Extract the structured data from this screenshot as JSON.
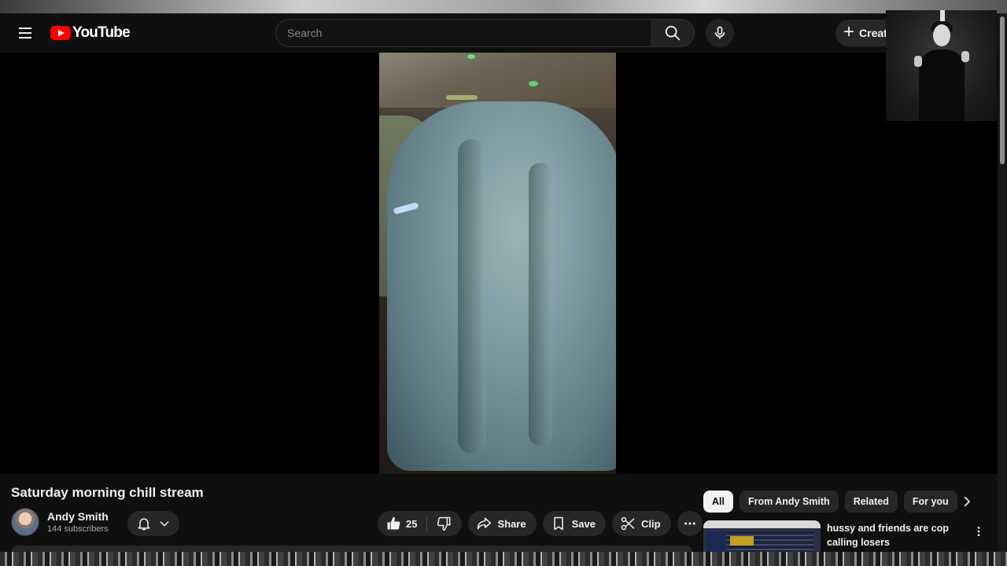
{
  "masthead": {
    "logo_text": "YouTube",
    "search_placeholder": "Search",
    "create_label": "Create"
  },
  "video": {
    "title": "Saturday morning chill stream",
    "channel": {
      "name": "Andy Smith",
      "subscribers": "144 subscribers"
    },
    "likes": "25",
    "actions": {
      "share": "Share",
      "save": "Save",
      "clip": "Clip"
    }
  },
  "sidebar": {
    "chips": [
      {
        "label": "All",
        "active": true
      },
      {
        "label": "From Andy Smith",
        "active": false
      },
      {
        "label": "Related",
        "active": false
      },
      {
        "label": "For you",
        "active": false
      }
    ],
    "recommendations": [
      {
        "title": "hussy and friends are cop calling losers"
      }
    ]
  },
  "icons": {
    "menu": "hamburger-icon",
    "search": "search-icon",
    "mic": "mic-icon",
    "create": "plus-icon",
    "bell": "bell-icon",
    "like": "thumbs-up-icon",
    "dislike": "thumbs-down-icon",
    "share": "share-arrow-icon",
    "save": "bookmark-icon",
    "clip": "scissors-icon",
    "more": "more-horizontal-icon",
    "chip_next": "chevron-right-icon",
    "rec_menu": "more-vertical-icon"
  },
  "colors": {
    "background": "#0f0f0f",
    "brand_red": "#ff0000",
    "pill": "#272727",
    "active_chip": "#f1f1f1"
  }
}
